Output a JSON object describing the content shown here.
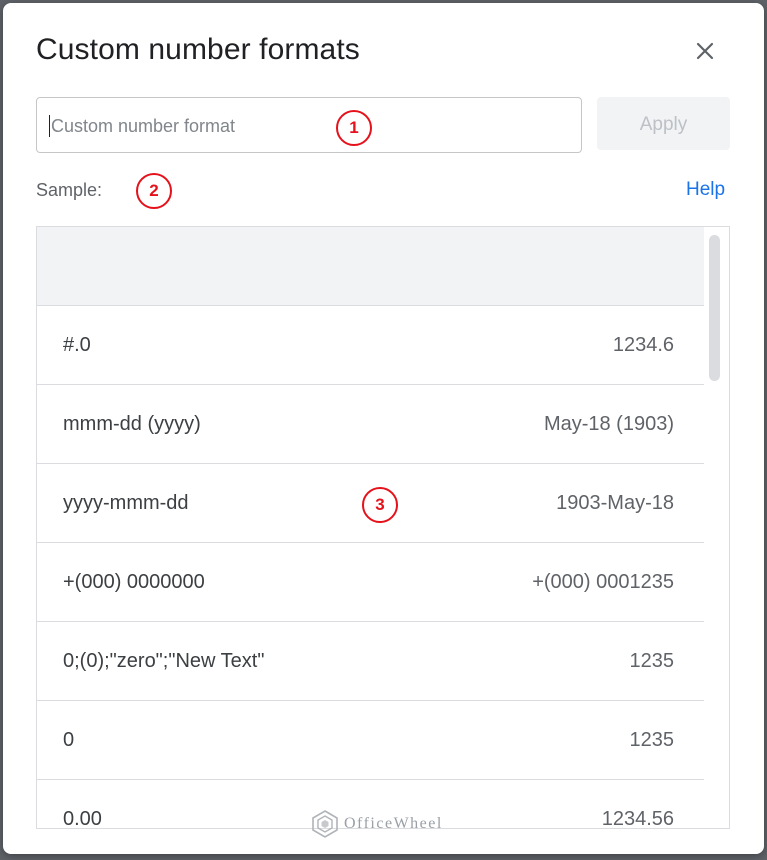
{
  "dialog": {
    "title": "Custom number formats",
    "close_icon": "close-icon"
  },
  "format_input": {
    "placeholder": "Custom number format",
    "value": ""
  },
  "apply_button": {
    "label": "Apply",
    "enabled": false
  },
  "sample": {
    "label": "Sample:"
  },
  "help_link": {
    "label": "Help"
  },
  "annotations": [
    "1",
    "2",
    "3"
  ],
  "formats": [
    {
      "format": "#.0",
      "sample": "1234.6"
    },
    {
      "format": "mmm-dd (yyyy)",
      "sample": "May-18 (1903)"
    },
    {
      "format": "yyyy-mmm-dd",
      "sample": "1903-May-18"
    },
    {
      "format": "+(000) 0000000",
      "sample": "+(000) 0001235"
    },
    {
      "format": "0;(0);\"zero\";\"New Text\"",
      "sample": "1235"
    },
    {
      "format": "0",
      "sample": "1235"
    },
    {
      "format": "0.00",
      "sample": "1234.56"
    }
  ],
  "watermark": {
    "text": "OfficeWheel",
    "icon": "officewheel-logo-icon"
  },
  "colors": {
    "accent_link": "#1a73e8",
    "annotation_red": "#e5121b",
    "header_bg": "#f1f3f4",
    "border": "#dadce0"
  }
}
